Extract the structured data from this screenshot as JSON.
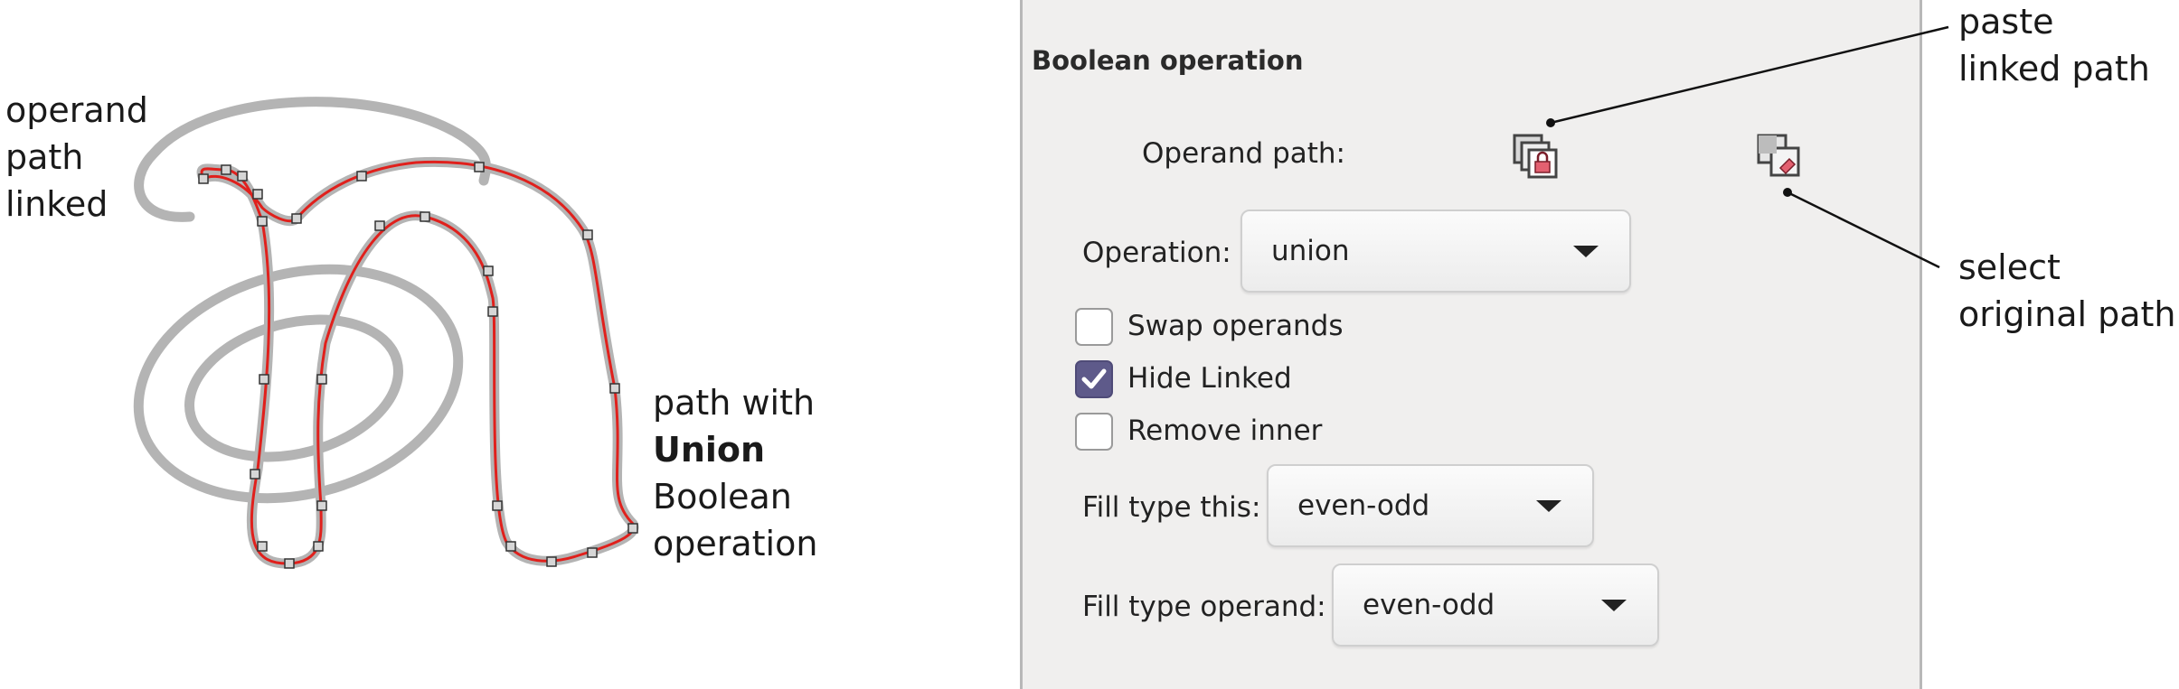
{
  "illustration": {
    "operand_note": [
      "operand",
      "path",
      "linked"
    ],
    "result_note": {
      "line1": "path with",
      "bold": "Union",
      "line3": "Boolean",
      "line4": "operation"
    },
    "colors": {
      "operand_stroke": "#b4b4b4",
      "result_path": "#e0201c",
      "node_fill": "#d6d6d6"
    }
  },
  "panel": {
    "title": "Boolean operation",
    "operand_path_label": "Operand path:",
    "paste_icon": "paste-linked-path-icon",
    "select_icon": "select-original-path-icon",
    "operation": {
      "label": "Operation:",
      "value": "union"
    },
    "checkboxes": [
      {
        "label": "Swap operands",
        "checked": false
      },
      {
        "label": "Hide Linked",
        "checked": true
      },
      {
        "label": "Remove inner",
        "checked": false
      }
    ],
    "fill_type_this": {
      "label": "Fill type this:",
      "value": "even-odd"
    },
    "fill_type_operand": {
      "label": "Fill type operand:",
      "value": "even-odd"
    },
    "colors": {
      "background": "#f0efee",
      "checkbox_checked": "#5e5a8a"
    }
  },
  "callouts": {
    "paste": [
      "paste",
      "linked path"
    ],
    "select": [
      "select",
      "original path"
    ]
  }
}
